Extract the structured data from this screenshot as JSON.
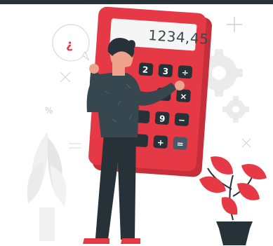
{
  "illustration": {
    "display_value": "1234,45",
    "speech_bubble_glyph": "¿",
    "percent_glyph": "%",
    "keys": [
      "2",
      "3",
      "÷",
      "×",
      "9",
      "−",
      "+",
      "="
    ],
    "colors": {
      "top_bar": "#263238",
      "calculator_body": "#e53945",
      "calculator_shade": "#c62f3a",
      "display_bg": "#f5f5f5",
      "key_bg": "#263238",
      "plant_red": "#e53945",
      "pot": "#263238",
      "gear": "#ebebeb",
      "shirt": "#37474f",
      "skin": "#f0a38c"
    },
    "icons": [
      "gear-icon",
      "plus-icon",
      "cross-icon",
      "percent-icon",
      "question-bubble-icon"
    ]
  }
}
